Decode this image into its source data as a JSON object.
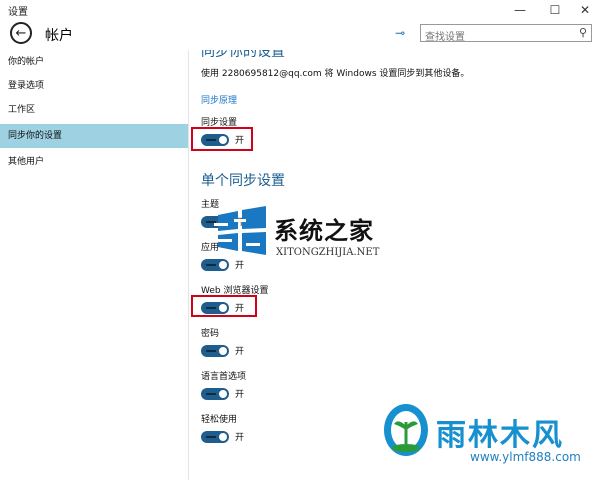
{
  "window": {
    "title": "设置",
    "minimize_icon": "minimize-icon",
    "maximize_icon": "maximize-icon",
    "close_icon": "close-icon"
  },
  "header": {
    "back_icon": "back-arrow-icon",
    "title": "帐户",
    "pin_icon": "pin-icon",
    "search_placeholder": "查找设置",
    "search_icon": "search-icon"
  },
  "sidebar": {
    "items": [
      {
        "label": "你的帐户",
        "active": false
      },
      {
        "label": "登录选项",
        "active": false
      },
      {
        "label": "工作区",
        "active": false
      },
      {
        "label": "同步你的设置",
        "active": true
      },
      {
        "label": "其他用户",
        "active": false
      }
    ]
  },
  "content": {
    "heading_partial": "同步你的设置",
    "description": "使用 2280695812@qq.com 将 Windows 设置同步到其他设备。",
    "link": "同步原理",
    "sync_settings": {
      "label": "同步设置",
      "state": "开"
    },
    "section_heading": "单个同步设置",
    "items": [
      {
        "label": "主题",
        "state": "开"
      },
      {
        "label": "应用",
        "state": "开"
      },
      {
        "label": "Web 浏览器设置",
        "state": "开"
      },
      {
        "label": "密码",
        "state": "开"
      },
      {
        "label": "语言首选项",
        "state": "开"
      },
      {
        "label": "轻松使用",
        "state": "开"
      }
    ]
  },
  "watermarks": {
    "top_text": "系统之家",
    "top_sub": "XITONGZHIJIA.NET",
    "bottom_text": "雨林木风",
    "bottom_url": "www.ylmf888.com"
  },
  "colors": {
    "accent": "#1e5d8c",
    "sidebar_active": "#9ed2e2",
    "highlight": "#d0021b",
    "link": "#1976c4"
  }
}
